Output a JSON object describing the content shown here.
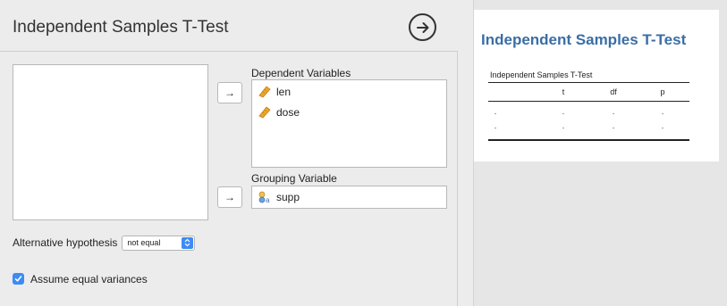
{
  "analysis": {
    "title": "Independent Samples T-Test",
    "run_icon": "arrow-circle-right-icon"
  },
  "variables": {
    "dependent_label": "Dependent Variables",
    "dependent_items": [
      {
        "name": "len",
        "icon": "scale-ruler-icon"
      },
      {
        "name": "dose",
        "icon": "scale-ruler-icon"
      }
    ],
    "grouping_label": "Grouping Variable",
    "grouping_items": [
      {
        "name": "supp",
        "icon": "nominal-variable-icon"
      }
    ],
    "assign_arrow": "→"
  },
  "options": {
    "alternative_label": "Alternative hypothesis",
    "alternative_value": "not equal",
    "equal_variances_label": "Assume equal variances",
    "equal_variances_checked": true
  },
  "results": {
    "heading": "Independent Samples T-Test",
    "table": {
      "caption": "Independent Samples T-Test",
      "columns": [
        "",
        "t",
        "df",
        "p"
      ],
      "rows": [
        [
          ".",
          ".",
          ".",
          "."
        ],
        [
          ".",
          ".",
          ".",
          "."
        ]
      ]
    }
  },
  "colors": {
    "accent": "#3d8bf5",
    "heading": "#3a6ea5",
    "scale_icon": "#e9a629"
  }
}
